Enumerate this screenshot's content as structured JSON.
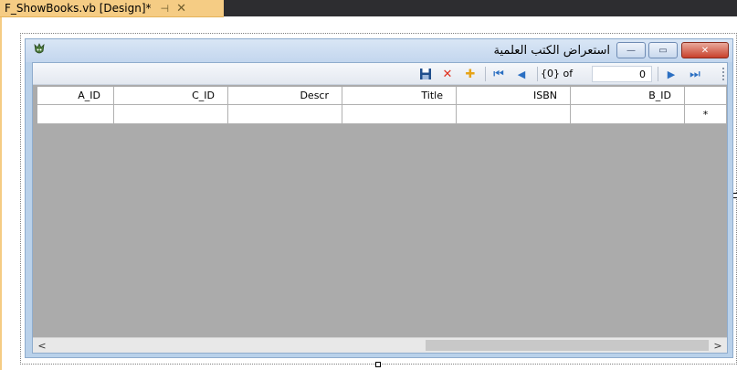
{
  "document_tab": {
    "title": "F_ShowBooks.vb [Design]*",
    "pin_glyph": "⊣",
    "close_glyph": "✕"
  },
  "form": {
    "caption": "استعراض الكتب العلمية",
    "buttons": {
      "minimize": "—",
      "maximize": "▭",
      "close": "✕"
    }
  },
  "navigator": {
    "save_icon": "save-icon",
    "delete_glyph": "✕",
    "add_glyph": "✚",
    "first_glyph": "⏮",
    "prev_glyph": "◀",
    "count_label": "{0} of",
    "position_value": "0",
    "next_glyph": "▶",
    "last_glyph": "⏭"
  },
  "grid": {
    "columns": [
      "B_ID",
      "ISBN",
      "Title",
      "Descr",
      "C_ID",
      "A_ID"
    ],
    "new_row_marker": "*"
  },
  "scrollbar": {
    "left_arrow": "<",
    "right_arrow": ">"
  },
  "colors": {
    "tab": "#f5cc84",
    "grid_background": "#ababab",
    "titlebar": "#c3d6ee",
    "close_button": "#c8412c"
  }
}
